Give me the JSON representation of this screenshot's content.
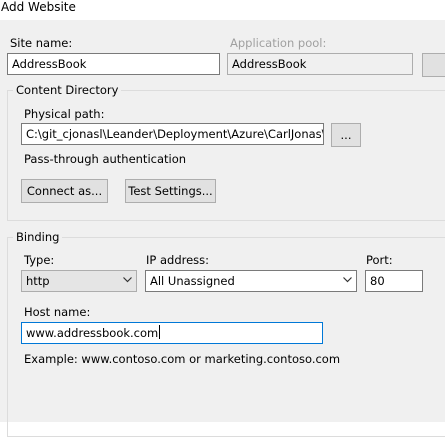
{
  "window": {
    "title": "Add Website"
  },
  "site": {
    "name_label": "Site name:",
    "name_value": "AddressBook",
    "pool_label": "Application pool:",
    "pool_value": "AddressBook"
  },
  "content_directory": {
    "title": "Content Directory",
    "physical_path_label": "Physical path:",
    "physical_path_value": "C:\\git_cjonasl\\Leander\\Deployment\\Azure\\CarlJonas\\Ac",
    "browse_label": "...",
    "passthrough_label": "Pass-through authentication",
    "connect_as_label": "Connect as...",
    "test_settings_label": "Test Settings..."
  },
  "binding": {
    "title": "Binding",
    "type_label": "Type:",
    "type_value": "http",
    "ip_label": "IP address:",
    "ip_value": "All Unassigned",
    "port_label": "Port:",
    "port_value": "80",
    "host_label": "Host name:",
    "host_value": "www.addressbook.com",
    "example_text": "Example: www.contoso.com or marketing.contoso.com"
  },
  "icons": {
    "dropdown": "chevron-down-icon"
  }
}
